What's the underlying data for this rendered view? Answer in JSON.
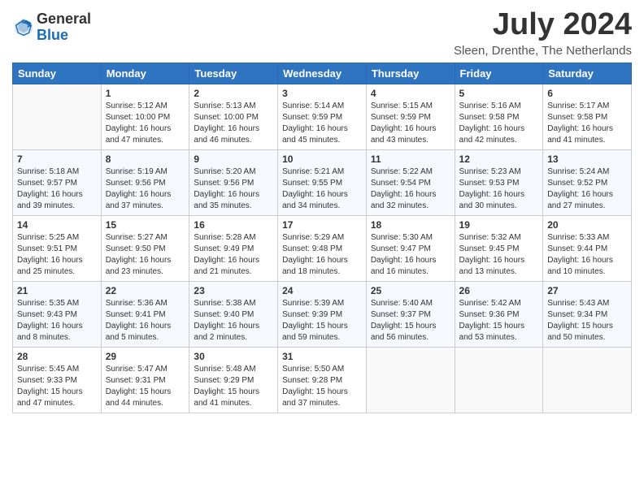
{
  "header": {
    "logo_general": "General",
    "logo_blue": "Blue",
    "month_year": "July 2024",
    "location": "Sleen, Drenthe, The Netherlands"
  },
  "weekdays": [
    "Sunday",
    "Monday",
    "Tuesday",
    "Wednesday",
    "Thursday",
    "Friday",
    "Saturday"
  ],
  "weeks": [
    [
      {
        "day": "",
        "sunrise": "",
        "sunset": "",
        "daylight": ""
      },
      {
        "day": "1",
        "sunrise": "Sunrise: 5:12 AM",
        "sunset": "Sunset: 10:00 PM",
        "daylight": "Daylight: 16 hours and 47 minutes."
      },
      {
        "day": "2",
        "sunrise": "Sunrise: 5:13 AM",
        "sunset": "Sunset: 10:00 PM",
        "daylight": "Daylight: 16 hours and 46 minutes."
      },
      {
        "day": "3",
        "sunrise": "Sunrise: 5:14 AM",
        "sunset": "Sunset: 9:59 PM",
        "daylight": "Daylight: 16 hours and 45 minutes."
      },
      {
        "day": "4",
        "sunrise": "Sunrise: 5:15 AM",
        "sunset": "Sunset: 9:59 PM",
        "daylight": "Daylight: 16 hours and 43 minutes."
      },
      {
        "day": "5",
        "sunrise": "Sunrise: 5:16 AM",
        "sunset": "Sunset: 9:58 PM",
        "daylight": "Daylight: 16 hours and 42 minutes."
      },
      {
        "day": "6",
        "sunrise": "Sunrise: 5:17 AM",
        "sunset": "Sunset: 9:58 PM",
        "daylight": "Daylight: 16 hours and 41 minutes."
      }
    ],
    [
      {
        "day": "7",
        "sunrise": "Sunrise: 5:18 AM",
        "sunset": "Sunset: 9:57 PM",
        "daylight": "Daylight: 16 hours and 39 minutes."
      },
      {
        "day": "8",
        "sunrise": "Sunrise: 5:19 AM",
        "sunset": "Sunset: 9:56 PM",
        "daylight": "Daylight: 16 hours and 37 minutes."
      },
      {
        "day": "9",
        "sunrise": "Sunrise: 5:20 AM",
        "sunset": "Sunset: 9:56 PM",
        "daylight": "Daylight: 16 hours and 35 minutes."
      },
      {
        "day": "10",
        "sunrise": "Sunrise: 5:21 AM",
        "sunset": "Sunset: 9:55 PM",
        "daylight": "Daylight: 16 hours and 34 minutes."
      },
      {
        "day": "11",
        "sunrise": "Sunrise: 5:22 AM",
        "sunset": "Sunset: 9:54 PM",
        "daylight": "Daylight: 16 hours and 32 minutes."
      },
      {
        "day": "12",
        "sunrise": "Sunrise: 5:23 AM",
        "sunset": "Sunset: 9:53 PM",
        "daylight": "Daylight: 16 hours and 30 minutes."
      },
      {
        "day": "13",
        "sunrise": "Sunrise: 5:24 AM",
        "sunset": "Sunset: 9:52 PM",
        "daylight": "Daylight: 16 hours and 27 minutes."
      }
    ],
    [
      {
        "day": "14",
        "sunrise": "Sunrise: 5:25 AM",
        "sunset": "Sunset: 9:51 PM",
        "daylight": "Daylight: 16 hours and 25 minutes."
      },
      {
        "day": "15",
        "sunrise": "Sunrise: 5:27 AM",
        "sunset": "Sunset: 9:50 PM",
        "daylight": "Daylight: 16 hours and 23 minutes."
      },
      {
        "day": "16",
        "sunrise": "Sunrise: 5:28 AM",
        "sunset": "Sunset: 9:49 PM",
        "daylight": "Daylight: 16 hours and 21 minutes."
      },
      {
        "day": "17",
        "sunrise": "Sunrise: 5:29 AM",
        "sunset": "Sunset: 9:48 PM",
        "daylight": "Daylight: 16 hours and 18 minutes."
      },
      {
        "day": "18",
        "sunrise": "Sunrise: 5:30 AM",
        "sunset": "Sunset: 9:47 PM",
        "daylight": "Daylight: 16 hours and 16 minutes."
      },
      {
        "day": "19",
        "sunrise": "Sunrise: 5:32 AM",
        "sunset": "Sunset: 9:45 PM",
        "daylight": "Daylight: 16 hours and 13 minutes."
      },
      {
        "day": "20",
        "sunrise": "Sunrise: 5:33 AM",
        "sunset": "Sunset: 9:44 PM",
        "daylight": "Daylight: 16 hours and 10 minutes."
      }
    ],
    [
      {
        "day": "21",
        "sunrise": "Sunrise: 5:35 AM",
        "sunset": "Sunset: 9:43 PM",
        "daylight": "Daylight: 16 hours and 8 minutes."
      },
      {
        "day": "22",
        "sunrise": "Sunrise: 5:36 AM",
        "sunset": "Sunset: 9:41 PM",
        "daylight": "Daylight: 16 hours and 5 minutes."
      },
      {
        "day": "23",
        "sunrise": "Sunrise: 5:38 AM",
        "sunset": "Sunset: 9:40 PM",
        "daylight": "Daylight: 16 hours and 2 minutes."
      },
      {
        "day": "24",
        "sunrise": "Sunrise: 5:39 AM",
        "sunset": "Sunset: 9:39 PM",
        "daylight": "Daylight: 15 hours and 59 minutes."
      },
      {
        "day": "25",
        "sunrise": "Sunrise: 5:40 AM",
        "sunset": "Sunset: 9:37 PM",
        "daylight": "Daylight: 15 hours and 56 minutes."
      },
      {
        "day": "26",
        "sunrise": "Sunrise: 5:42 AM",
        "sunset": "Sunset: 9:36 PM",
        "daylight": "Daylight: 15 hours and 53 minutes."
      },
      {
        "day": "27",
        "sunrise": "Sunrise: 5:43 AM",
        "sunset": "Sunset: 9:34 PM",
        "daylight": "Daylight: 15 hours and 50 minutes."
      }
    ],
    [
      {
        "day": "28",
        "sunrise": "Sunrise: 5:45 AM",
        "sunset": "Sunset: 9:33 PM",
        "daylight": "Daylight: 15 hours and 47 minutes."
      },
      {
        "day": "29",
        "sunrise": "Sunrise: 5:47 AM",
        "sunset": "Sunset: 9:31 PM",
        "daylight": "Daylight: 15 hours and 44 minutes."
      },
      {
        "day": "30",
        "sunrise": "Sunrise: 5:48 AM",
        "sunset": "Sunset: 9:29 PM",
        "daylight": "Daylight: 15 hours and 41 minutes."
      },
      {
        "day": "31",
        "sunrise": "Sunrise: 5:50 AM",
        "sunset": "Sunset: 9:28 PM",
        "daylight": "Daylight: 15 hours and 37 minutes."
      },
      {
        "day": "",
        "sunrise": "",
        "sunset": "",
        "daylight": ""
      },
      {
        "day": "",
        "sunrise": "",
        "sunset": "",
        "daylight": ""
      },
      {
        "day": "",
        "sunrise": "",
        "sunset": "",
        "daylight": ""
      }
    ]
  ]
}
